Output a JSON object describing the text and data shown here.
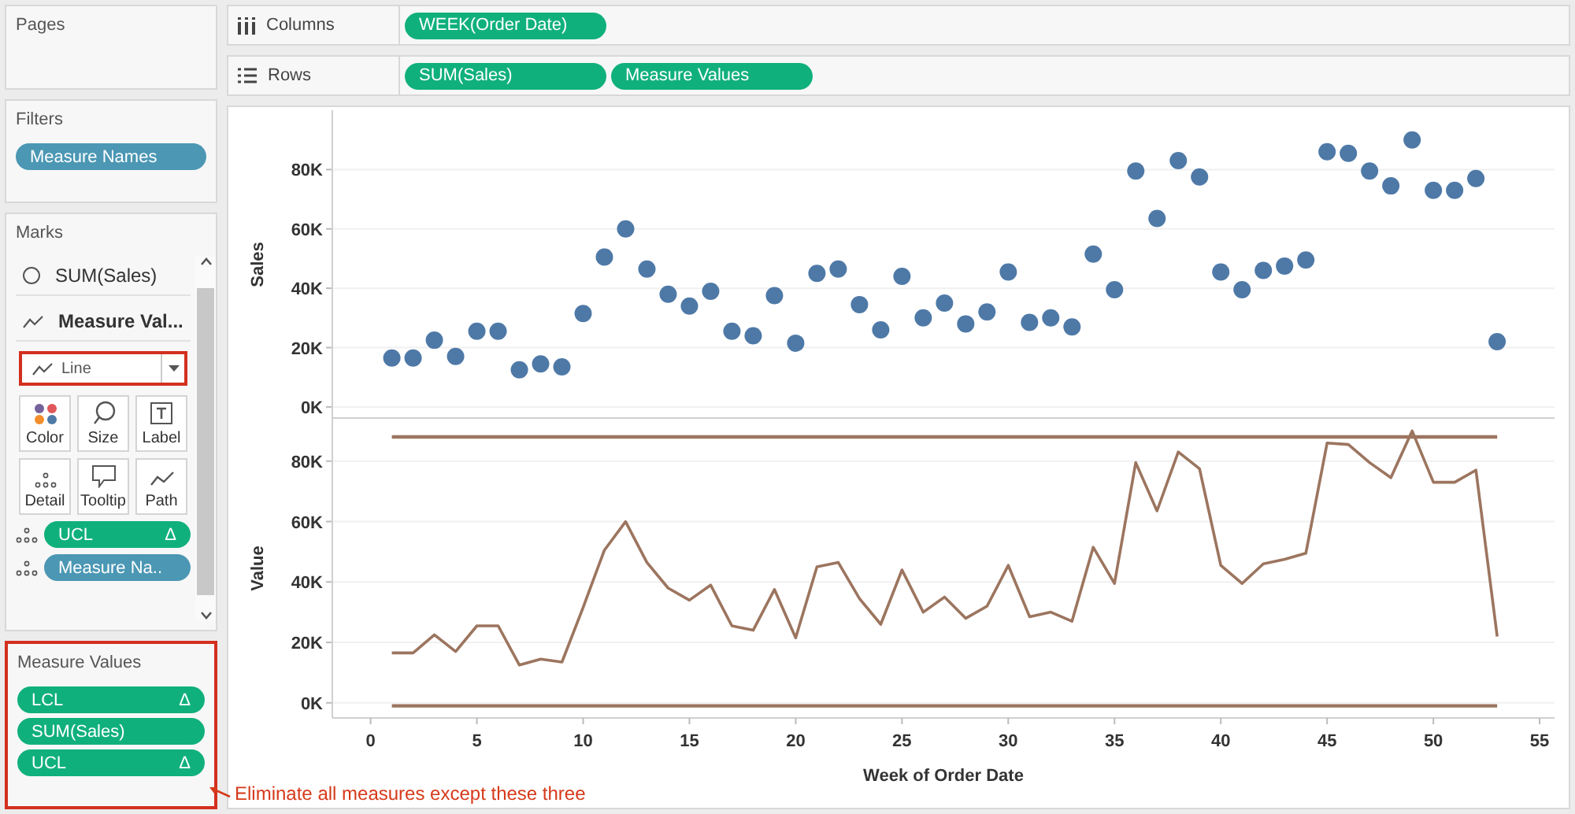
{
  "pages": {
    "title": "Pages"
  },
  "filters": {
    "title": "Filters",
    "pills": [
      {
        "label": "Measure Names",
        "kind": "dimension"
      }
    ]
  },
  "marks": {
    "title": "Marks",
    "cards": [
      {
        "label": "SUM(Sales)",
        "kind": "circle",
        "selected": false
      },
      {
        "label": "Measure Val...",
        "kind": "line",
        "selected": true
      }
    ],
    "mark_type": {
      "value": "Line",
      "highlighted": true
    },
    "buttons": [
      {
        "label": "Color",
        "kind": "color"
      },
      {
        "label": "Size",
        "kind": "size"
      },
      {
        "label": "Label",
        "kind": "label"
      },
      {
        "label": "Detail",
        "kind": "detail"
      },
      {
        "label": "Tooltip",
        "kind": "tooltip"
      },
      {
        "label": "Path",
        "kind": "path"
      }
    ],
    "pills": [
      {
        "label": "UCL",
        "kind": "measure",
        "delta": "Δ"
      },
      {
        "label": "Measure Na..",
        "kind": "dimension"
      }
    ]
  },
  "measure_values": {
    "title": "Measure Values",
    "highlighted": true,
    "pills": [
      {
        "label": "LCL",
        "kind": "measure",
        "delta": "Δ"
      },
      {
        "label": "SUM(Sales)",
        "kind": "measure"
      },
      {
        "label": "UCL",
        "kind": "measure",
        "delta": "Δ"
      }
    ]
  },
  "shelves": [
    {
      "label": "Columns",
      "kind": "columns",
      "pills": [
        {
          "label": "WEEK(Order Date)",
          "kind": "measure"
        }
      ]
    },
    {
      "label": "Rows",
      "kind": "rows",
      "pills": [
        {
          "label": "SUM(Sales)",
          "kind": "measure"
        },
        {
          "label": "Measure Values",
          "kind": "measure"
        }
      ]
    }
  ],
  "panes": [
    {
      "chart_data": {
        "type": "scatter",
        "ylabel": "Sales",
        "grid": true,
        "x": [
          1,
          2,
          3,
          4,
          5,
          6,
          7,
          8,
          9,
          10,
          11,
          12,
          13,
          14,
          15,
          16,
          17,
          18,
          19,
          20,
          21,
          22,
          23,
          24,
          25,
          26,
          27,
          28,
          29,
          30,
          31,
          32,
          33,
          34,
          35,
          36,
          37,
          38,
          39,
          40,
          41,
          42,
          43,
          44,
          45,
          46,
          47,
          48,
          49,
          50,
          51,
          52,
          53
        ],
        "xlim": [
          -1.8,
          55.7
        ],
        "ylim": [
          -4,
          100
        ],
        "yticks": [
          {
            "value": 0,
            "label": "0K"
          },
          {
            "value": 20,
            "label": "20K"
          },
          {
            "value": 40,
            "label": "40K"
          },
          {
            "value": 60,
            "label": "60K"
          },
          {
            "value": 80,
            "label": "80K"
          }
        ],
        "series": [
          {
            "color": "#4e79a7",
            "values": [
              16.5,
              16.5,
              22.5,
              17,
              25.5,
              25.5,
              12.5,
              14.5,
              13.5,
              31.5,
              50.5,
              60,
              46.5,
              38,
              34,
              39,
              25.5,
              24,
              37.5,
              21.5,
              45,
              46.5,
              34.5,
              26,
              44,
              30,
              35,
              28,
              32,
              45.5,
              28.5,
              30,
              27,
              51.5,
              39.5,
              79.5,
              63.5,
              83,
              77.5,
              45.5,
              39.5,
              46,
              47.5,
              49.5,
              86,
              85.5,
              79.5,
              74.5,
              90,
              73,
              73,
              77,
              22
            ]
          }
        ]
      }
    },
    {
      "chart_data": {
        "type": "line",
        "ylabel": "Value",
        "grid": true,
        "xlabel": "Week of Order Date",
        "x": [
          1,
          2,
          3,
          4,
          5,
          6,
          7,
          8,
          9,
          10,
          11,
          12,
          13,
          14,
          15,
          16,
          17,
          18,
          19,
          20,
          21,
          22,
          23,
          24,
          25,
          26,
          27,
          28,
          29,
          30,
          31,
          32,
          33,
          34,
          35,
          36,
          37,
          38,
          39,
          40,
          41,
          42,
          43,
          44,
          45,
          46,
          47,
          48,
          49,
          50,
          51,
          52,
          53
        ],
        "xlim": [
          -1.8,
          55.7
        ],
        "ylim": [
          -5,
          94
        ],
        "xticks": [
          0,
          5,
          10,
          15,
          20,
          25,
          30,
          35,
          40,
          45,
          50,
          55
        ],
        "yticks": [
          {
            "value": 0,
            "label": "0K"
          },
          {
            "value": 20,
            "label": "20K"
          },
          {
            "value": 40,
            "label": "40K"
          },
          {
            "value": 60,
            "label": "60K"
          },
          {
            "value": 80,
            "label": "80K"
          }
        ],
        "series": [
          {
            "color": "#9c755f",
            "values": [
              -1,
              -1,
              -1,
              -1,
              -1,
              -1,
              -1,
              -1,
              -1,
              -1,
              -1,
              -1,
              -1,
              -1,
              -1,
              -1,
              -1,
              -1,
              -1,
              -1,
              -1,
              -1,
              -1,
              -1,
              -1,
              -1,
              -1,
              -1,
              -1,
              -1,
              -1,
              -1,
              -1,
              -1,
              -1,
              -1,
              -1,
              -1,
              -1,
              -1,
              -1,
              -1,
              -1,
              -1,
              -1,
              -1,
              -1,
              -1,
              -1,
              -1,
              -1,
              -1,
              -1
            ]
          },
          {
            "color": "#9c755f",
            "values": [
              16.5,
              16.5,
              22.5,
              17,
              25.5,
              25.5,
              12.5,
              14.5,
              13.5,
              31.5,
              50.5,
              60,
              46.5,
              38,
              34,
              39,
              25.5,
              24,
              37.5,
              21.5,
              45,
              46.5,
              34.5,
              26,
              44,
              30,
              35,
              28,
              32,
              45.5,
              28.5,
              30,
              27,
              51.5,
              39.5,
              79.5,
              63.5,
              83,
              77.5,
              45.5,
              39.5,
              46,
              47.5,
              49.5,
              86,
              85.5,
              79.5,
              74.5,
              90,
              73,
              73,
              77,
              22
            ]
          },
          {
            "color": "#9c755f",
            "values": [
              88,
              88,
              88,
              88,
              88,
              88,
              88,
              88,
              88,
              88,
              88,
              88,
              88,
              88,
              88,
              88,
              88,
              88,
              88,
              88,
              88,
              88,
              88,
              88,
              88,
              88,
              88,
              88,
              88,
              88,
              88,
              88,
              88,
              88,
              88,
              88,
              88,
              88,
              88,
              88,
              88,
              88,
              88,
              88,
              88,
              88,
              88,
              88,
              88,
              88,
              88,
              88,
              88
            ]
          }
        ]
      }
    }
  ],
  "annotation": {
    "text": "Eliminate all measures except these three"
  }
}
